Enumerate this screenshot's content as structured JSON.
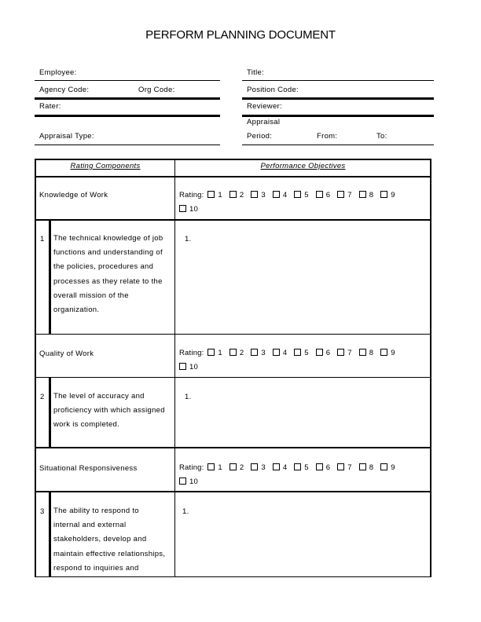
{
  "document": {
    "title": "PERFORM PLANNING DOCUMENT"
  },
  "header_fields": {
    "employee": "Employee:",
    "title": "Title:",
    "agency_code": "Agency Code:",
    "org_code": "Org Code:",
    "position_code": "Position Code:",
    "rater": "Rater:",
    "reviewer": "Reviewer:",
    "appraisal_type": "Appraisal Type:",
    "appraisal_period_line1": "Appraisal",
    "appraisal_period_line2": "Period:",
    "from": "From:",
    "to": "To:"
  },
  "table": {
    "headers": {
      "rating_components": "Rating Components",
      "performance_objectives": "Performance Objectives"
    },
    "rating_label": "Rating:",
    "rating_options": [
      "1",
      "2",
      "3",
      "4",
      "5",
      "6",
      "7",
      "8",
      "9",
      "10"
    ],
    "components": [
      {
        "name": "Knowledge of Work",
        "number": "1",
        "description": [
          "The technical knowledge of job",
          "functions and understanding of",
          "the policies, procedures and",
          "processes as they relate to the",
          "overall mission of the",
          "organization."
        ],
        "objective": "1."
      },
      {
        "name": "Quality of Work",
        "number": "2",
        "description": [
          "The level of accuracy and",
          "proficiency with which assigned",
          "work is completed."
        ],
        "objective": "1."
      },
      {
        "name": "Situational Responsiveness",
        "number": "3",
        "description": [
          "The ability to respond to",
          "internal and external",
          "stakeholders, develop and",
          "maintain effective relationships,",
          "respond to inquiries and"
        ],
        "objective": "1."
      }
    ]
  }
}
